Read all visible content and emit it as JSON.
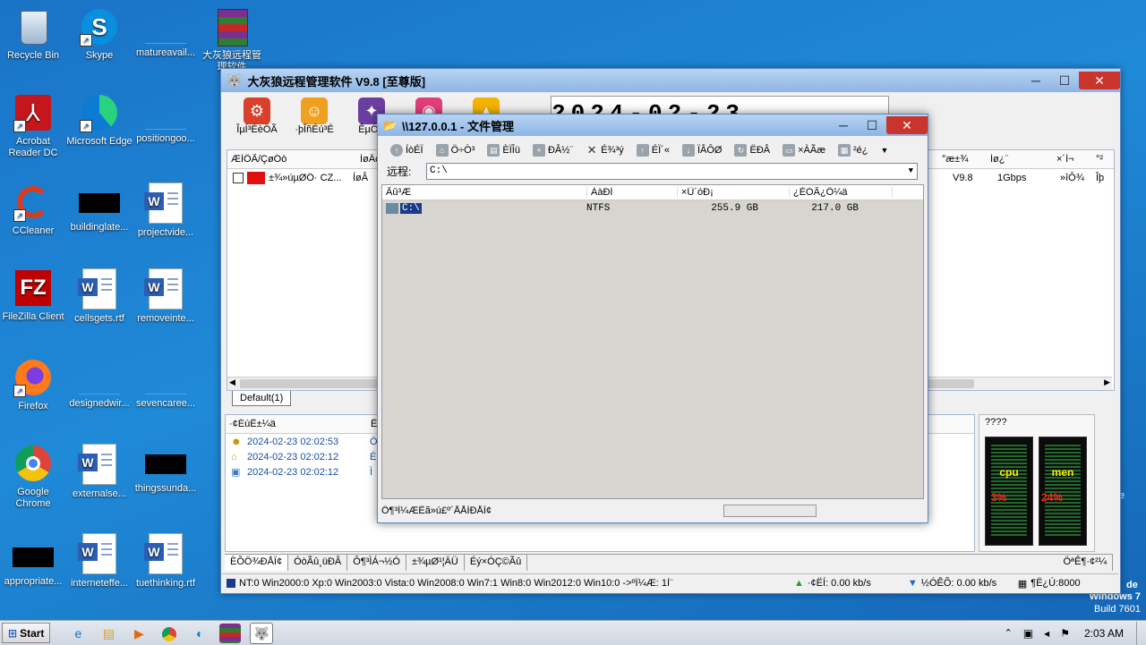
{
  "desktop": {
    "icons": [
      {
        "label": "Recycle Bin"
      },
      {
        "label": "Skype"
      },
      {
        "label": "matureavail..."
      },
      {
        "label": "大灰狼远程管理软件"
      },
      {
        "label": "Acrobat Reader DC"
      },
      {
        "label": "Microsoft Edge"
      },
      {
        "label": "positiongoo..."
      },
      {
        "label": "CCleaner"
      },
      {
        "label": "buildinglate..."
      },
      {
        "label": "projectvide..."
      },
      {
        "label": "FileZilla Client"
      },
      {
        "label": "cellsgets.rtf"
      },
      {
        "label": "removeinte..."
      },
      {
        "label": "Firefox"
      },
      {
        "label": "designedwir..."
      },
      {
        "label": "sevencaree..."
      },
      {
        "label": "Google Chrome"
      },
      {
        "label": "externalse..."
      },
      {
        "label": "thingssunda..."
      },
      {
        "label": "appropriate..."
      },
      {
        "label": "interneteffe..."
      },
      {
        "label": "tuethinking.rtf"
      }
    ],
    "watermark": {
      "line1": "Windows 7",
      "line2": "Build 7601",
      "side": "de",
      "side2": "e"
    }
  },
  "main_window": {
    "title": "大灰狼远程管理软件 V9.8 [至尊版]",
    "clock": "2024-02-23 02:02:43",
    "toolbar": [
      {
        "label": "ÎµÍ³ÉèÖÃ",
        "color": "#d9412c",
        "icon": "gear-icon"
      },
      {
        "label": "·þÎñÉú³É",
        "color": "#f0a020",
        "icon": "user-icon"
      },
      {
        "label": "ÊµÓÃ",
        "color": "#6b3fa0",
        "icon": "tools-icon"
      },
      {
        "label": "",
        "color": "#e0407a",
        "icon": "camera-icon"
      },
      {
        "label": "",
        "color": "#f5b400",
        "icon": "upload-icon"
      }
    ],
    "grid": {
      "headers": [
        "ÆÌÖÃ/ÇøÓò",
        "ÍøÂç",
        "",
        "",
        "",
        "",
        "",
        "",
        "",
        "",
        "",
        "",
        "",
        "°æ±¾",
        "Íø¿¨",
        "×´Ì¬",
        "°²"
      ],
      "right_headers": [
        "Æµ",
        "°æ±¾",
        "Íø¿¨",
        "×´Ì¬",
        "°²"
      ],
      "row": {
        "flag": "china",
        "region": "±¾»úµØÖ· CZ...",
        "net": "ÍøÂ",
        "version": "V9.8",
        "nic": "1Gbps",
        "status": "»îÔ¾",
        "av": "Îþ"
      }
    },
    "group_tab": "Default(1)",
    "log": {
      "header_col1": "·¢ÉúÊ±¼ä",
      "header_col2": "ÊÂ",
      "rows": [
        {
          "time": "2024-02-23 02:02:53",
          "tail": "Ö"
        },
        {
          "time": "2024-02-23 02:02:12",
          "tail": "É"
        },
        {
          "time": "2024-02-23 02:02:12",
          "tail": "Ì"
        }
      ]
    },
    "monitor": {
      "title": "????",
      "cpu_label": "cpu",
      "cpu_value": "3%",
      "mem_label": "men",
      "mem_value": "24%"
    },
    "bottom_tabs": [
      "ÈÕÖ¾ÐÅÏ¢",
      "ÓòÃû¸üÐÂ",
      "Ô¶³ÌÁ¬½Ó",
      "±¾µØ¹¦ÄÜ",
      "Éý×ÓÇ©Ãû",
      "ÖªÊ¶·¢²¼"
    ],
    "status": {
      "os_counts": "NT:0 Win2000:0 Xp:0 Win2003:0 Vista:0 Win2008:0 Win7:1 Win8:0 Win2012:0 Win10:0 ->ºÏ¼Æ: 1Ì¨",
      "upload": "·¢ËÍ: 0.00 kb/s",
      "download": "½ÓÊÕ: 0.00 kb/s",
      "port": "¶Ë¿Ú:8000"
    }
  },
  "file_manager": {
    "title": "\\\\127.0.0.1 - 文件管理",
    "toolbar": [
      "ÍòÉÏ",
      "Ö÷Ò³",
      "ÈÏÎü",
      "ÐÂ½¨",
      "É¾³ý",
      "ÉÏ´«",
      "ÏÂÔØ",
      "ËÐÂ",
      "×ÀÃæ",
      "²é¿"
    ],
    "path_label": "远程:",
    "path_value": "C:\\",
    "columns": [
      "Ãû³Æ",
      "ÀàÐÍ",
      "×Ü´óÐ¡",
      "¿ÉÓÃ¿Õ¼ä"
    ],
    "rows": [
      {
        "name": "C:\\",
        "type": "NTFS",
        "total": "255.9 GB",
        "free": "217.0 GB"
      }
    ],
    "status": "Ô¶³Ì¼ÆËã»ú£º´ÅÅÌÐÅÏ¢"
  },
  "taskbar": {
    "start_label": "Start",
    "time": "2:03 AM"
  }
}
